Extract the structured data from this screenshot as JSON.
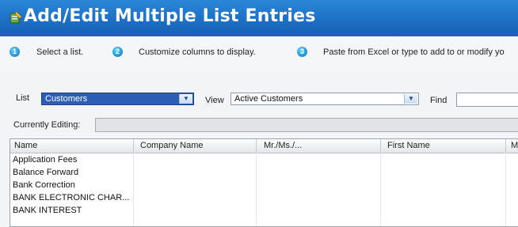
{
  "window": {
    "title": "Add/Edit Multiple List Entries",
    "app_icon": "quickbooks-pencil-icon"
  },
  "steps": [
    {
      "number": "1",
      "text": "Select a list."
    },
    {
      "number": "2",
      "text": "Customize columns to display."
    },
    {
      "number": "3",
      "text": "Paste from Excel or type to add to or modify yo"
    }
  ],
  "controls": {
    "list_label": "List",
    "list_value": "Customers",
    "view_label": "View",
    "view_value": "Active Customers",
    "find_label": "Find",
    "find_value": "",
    "currently_editing_label": "Currently Editing:",
    "currently_editing_value": ""
  },
  "table": {
    "columns": [
      "Name",
      "Company Name",
      "Mr./Ms./...",
      "First Name",
      "M."
    ],
    "rows": [
      "Application Fees",
      "Balance Forward",
      "Bank Correction",
      "BANK ELECTRONIC CHAR...",
      "BANK INTEREST"
    ]
  },
  "colors": {
    "title_bar": "#1d70c6",
    "selected_dropdown": "#2a5fb5",
    "step_badge": "#1b8fd3"
  }
}
